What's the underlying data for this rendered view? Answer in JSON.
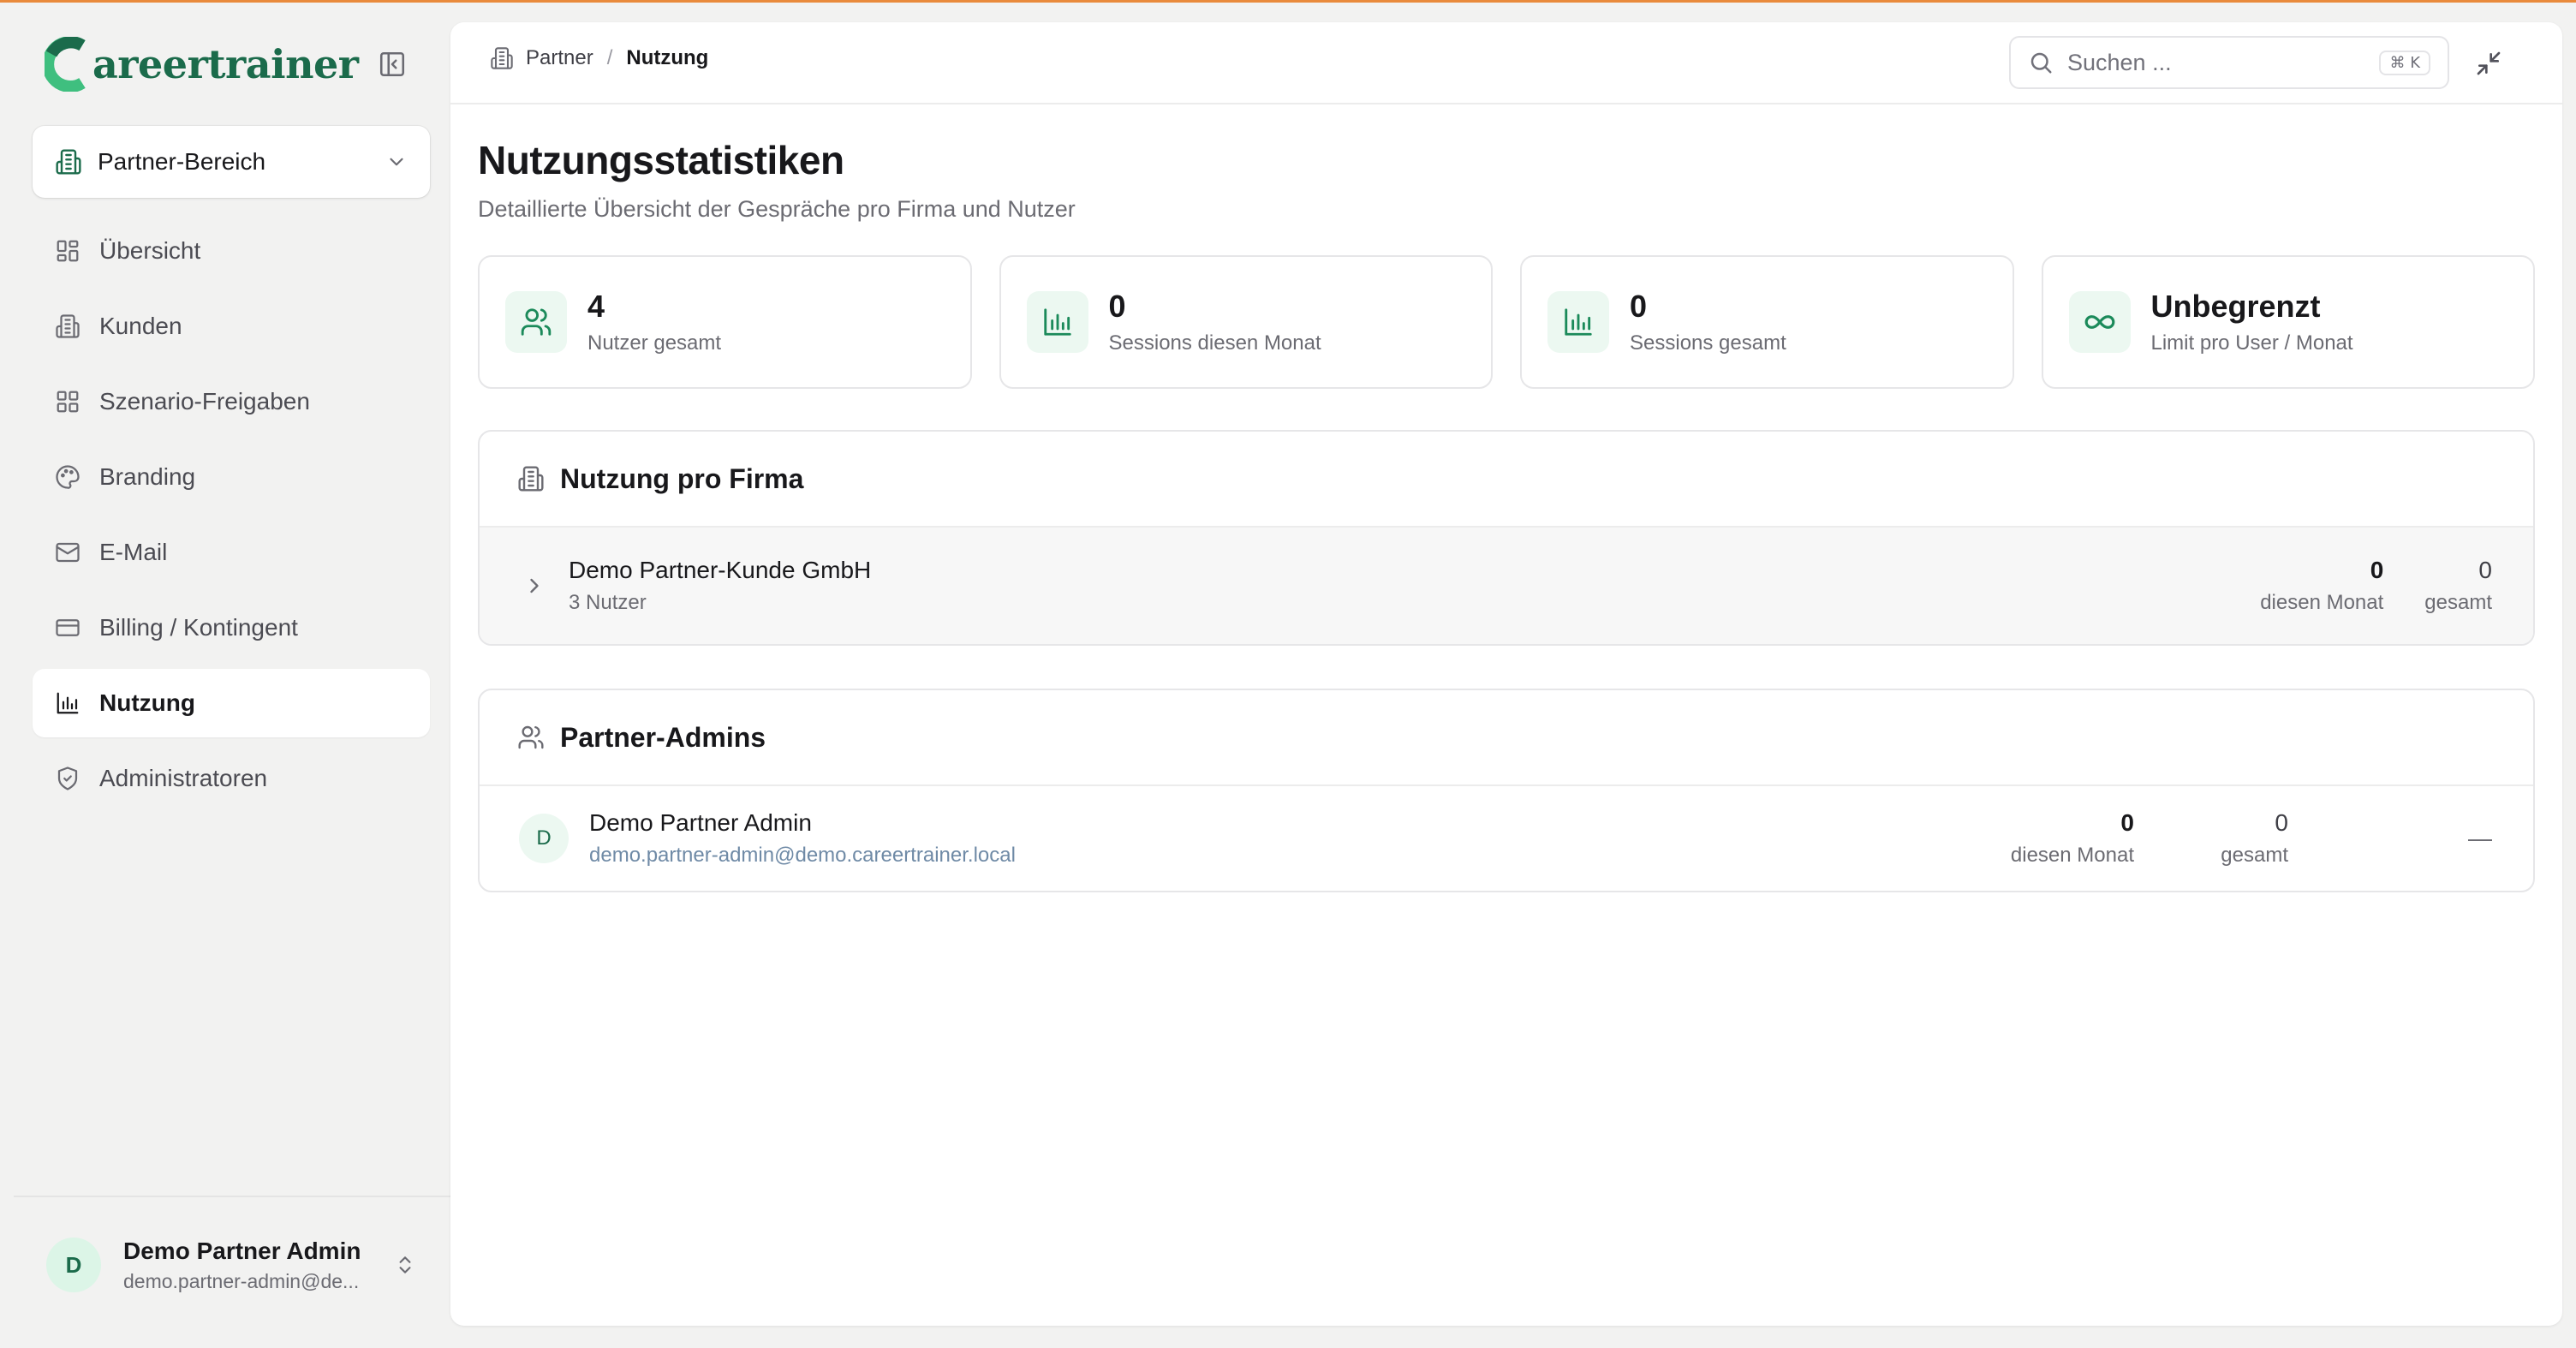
{
  "brand": {
    "logo_text": "areertrainer",
    "accent_color": "#1b6b4b",
    "top_accent_color": "#e98a3c"
  },
  "sidebar": {
    "area_selector": {
      "label": "Partner-Bereich",
      "icon": "building-icon"
    },
    "items": [
      {
        "label": "Übersicht",
        "icon": "grid-icon",
        "active": false
      },
      {
        "label": "Kunden",
        "icon": "building-icon",
        "active": false
      },
      {
        "label": "Szenario-Freigaben",
        "icon": "grid-icon",
        "active": false
      },
      {
        "label": "Branding",
        "icon": "palette-icon",
        "active": false
      },
      {
        "label": "E-Mail",
        "icon": "mail-icon",
        "active": false
      },
      {
        "label": "Billing / Kontingent",
        "icon": "credit-card-icon",
        "active": false
      },
      {
        "label": "Nutzung",
        "icon": "bar-chart-icon",
        "active": true
      },
      {
        "label": "Administratoren",
        "icon": "shield-icon",
        "active": false
      }
    ],
    "user": {
      "initial": "D",
      "name": "Demo Partner Admin",
      "email": "demo.partner-admin@de..."
    }
  },
  "topbar": {
    "breadcrumb": {
      "parent": "Partner",
      "separator": "/",
      "current": "Nutzung"
    },
    "search": {
      "placeholder": "Suchen ...",
      "shortcut": "⌘ K"
    }
  },
  "page": {
    "title": "Nutzungsstatistiken",
    "subtitle": "Detaillierte Übersicht der Gespräche pro Firma und Nutzer"
  },
  "stats": [
    {
      "value": "4",
      "label": "Nutzer gesamt",
      "icon": "users-icon"
    },
    {
      "value": "0",
      "label": "Sessions diesen Monat",
      "icon": "bar-chart-icon"
    },
    {
      "value": "0",
      "label": "Sessions gesamt",
      "icon": "bar-chart-icon"
    },
    {
      "value": "Unbegrenzt",
      "label": "Limit pro User / Monat",
      "icon": "infinity-icon"
    }
  ],
  "usage_by_company": {
    "title": "Nutzung pro Firma",
    "rows": [
      {
        "name": "Demo Partner-Kunde GmbH",
        "sub": "3 Nutzer",
        "month_value": "0",
        "month_label": "diesen Monat",
        "total_value": "0",
        "total_label": "gesamt"
      }
    ]
  },
  "partner_admins": {
    "title": "Partner-Admins",
    "rows": [
      {
        "initial": "D",
        "name": "Demo Partner Admin",
        "email": "demo.partner-admin@demo.careertrainer.local",
        "month_value": "0",
        "month_label": "diesen Monat",
        "total_value": "0",
        "total_label": "gesamt",
        "limit": "—"
      }
    ]
  }
}
